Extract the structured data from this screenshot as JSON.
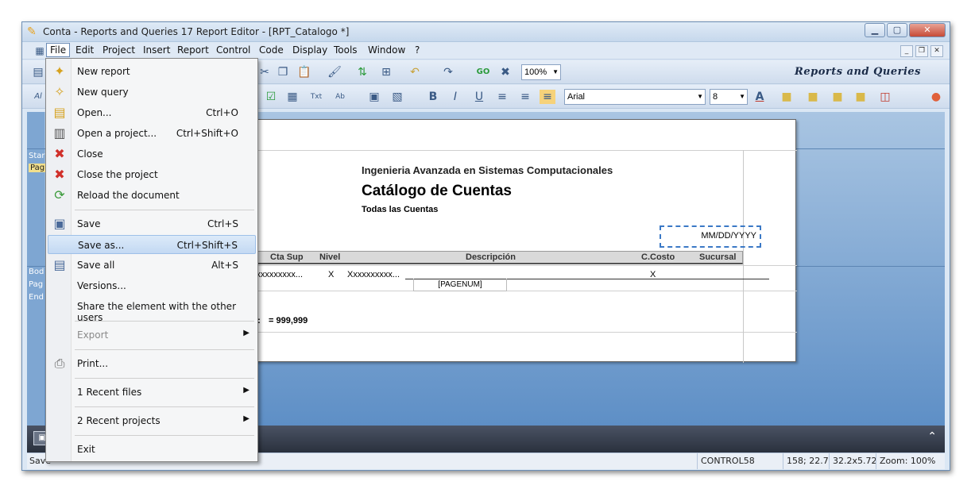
{
  "window": {
    "title": "Conta - Reports and Queries 17  Report Editor - [RPT_Catalogo *]",
    "logo": "Reports and Queries"
  },
  "menubar": {
    "items": [
      "File",
      "Edit",
      "Project",
      "Insert",
      "Report",
      "Control",
      "Code",
      "Display",
      "Tools",
      "Window",
      "?"
    ]
  },
  "toolbar": {
    "zoom": "100%",
    "font": "Arial",
    "size": "8"
  },
  "left_panel": {
    "labels": [
      "Star",
      "Pag",
      "Bod",
      "Pag",
      "End"
    ]
  },
  "report": {
    "company": "Ingenieria Avanzada en Sistemas Computacionales",
    "title": "Catálogo de Cuentas",
    "subtitle": "Todas las Cuentas",
    "date_field": "MM/DD/YYYY",
    "columns": [
      "Cta Sup",
      "Nivel",
      "Descripción",
      "C.Costo",
      "Sucursal"
    ],
    "row": {
      "cta_sup": "Xxxxxxxxxx...",
      "nivel": "X",
      "descripcion": "Xxxxxxxxxx...",
      "ccosto": "X"
    },
    "pagenum": "[PAGENUM]",
    "total_label": "s :",
    "total_value": "= 999,999"
  },
  "file_menu": {
    "items": [
      {
        "label": "New report",
        "shortcut": "",
        "icon": "new-report-icon"
      },
      {
        "label": "New query",
        "shortcut": "",
        "icon": "new-query-icon"
      },
      {
        "label": "Open...",
        "shortcut": "Ctrl+O",
        "icon": "open-icon"
      },
      {
        "label": "Open a project...",
        "shortcut": "Ctrl+Shift+O",
        "icon": "open-project-icon"
      },
      {
        "label": "Close",
        "shortcut": "",
        "icon": "close-x-icon"
      },
      {
        "label": "Close the project",
        "shortcut": "",
        "icon": "close-project-icon"
      },
      {
        "label": "Reload the document",
        "shortcut": "",
        "icon": "reload-icon"
      },
      {
        "label": "Save",
        "shortcut": "Ctrl+S",
        "icon": "save-icon"
      },
      {
        "label": "Save as...",
        "shortcut": "Ctrl+Shift+S",
        "icon": "save-as-icon"
      },
      {
        "label": "Save all",
        "shortcut": "Alt+S",
        "icon": "save-all-icon"
      },
      {
        "label": "Versions...",
        "shortcut": "",
        "icon": ""
      },
      {
        "label": "Share the element with the other users",
        "shortcut": "",
        "icon": ""
      },
      {
        "label": "Export",
        "shortcut": "",
        "icon": ""
      },
      {
        "label": "Print...",
        "shortcut": "",
        "icon": "print-icon"
      },
      {
        "label": "1 Recent files",
        "shortcut": "",
        "icon": ""
      },
      {
        "label": "2 Recent projects",
        "shortcut": "",
        "icon": ""
      },
      {
        "label": "Exit",
        "shortcut": "",
        "icon": ""
      }
    ]
  },
  "statusbar": {
    "message": "Save",
    "control": "CONTROL58",
    "position": "158; 22.7",
    "size": "32.2x5.72",
    "zoom": "Zoom: 100%"
  },
  "colors": {
    "accent": "#3b79c6",
    "workspace": "#5e8fc6"
  }
}
